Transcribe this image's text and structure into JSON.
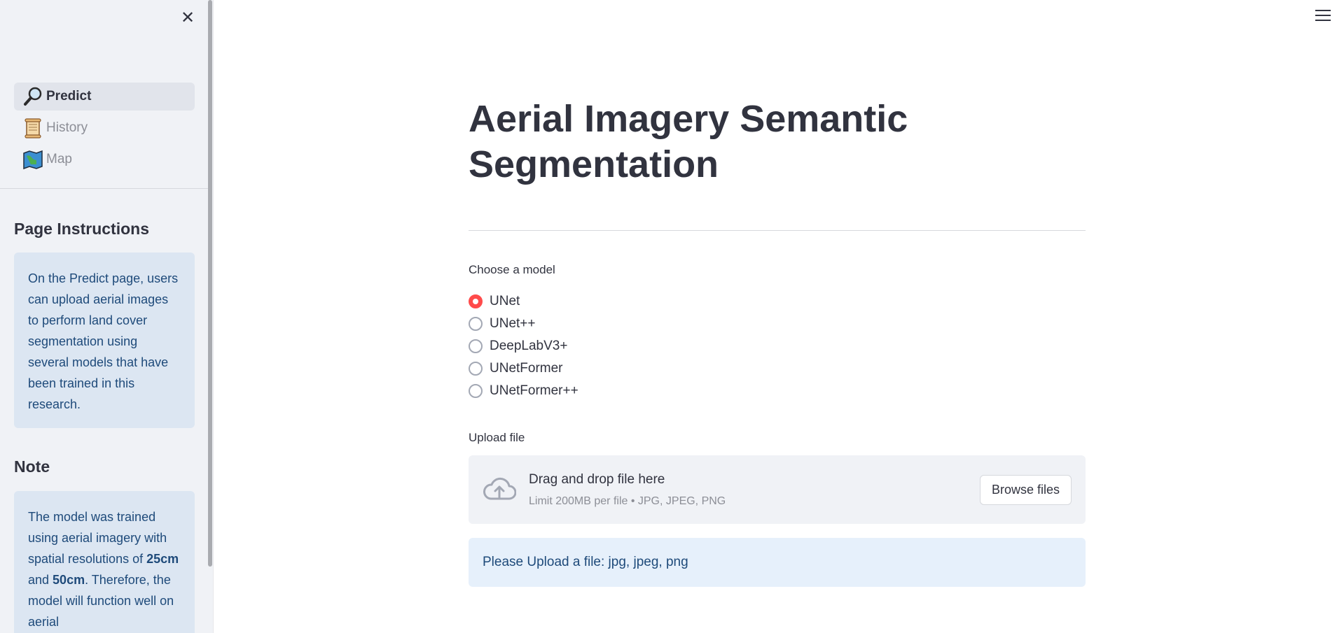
{
  "sidebar": {
    "close_icon": "close-icon",
    "nav": [
      {
        "label": "Predict",
        "icon": "magnifier-icon",
        "active": true
      },
      {
        "label": "History",
        "icon": "scroll-icon",
        "active": false
      },
      {
        "label": "Map",
        "icon": "map-icon",
        "active": false
      }
    ],
    "instructions_heading": "Page Instructions",
    "instructions_text": "On the Predict page, users can upload aerial images to perform land cover segmentation using several models that have been trained in this research.",
    "note_heading": "Note",
    "note": {
      "t1": "The model was trained using aerial imagery with spatial resolutions of ",
      "b1": "25cm",
      "t2": " and ",
      "b2": "50cm",
      "t3": ". Therefore, the model will function well on aerial"
    }
  },
  "header": {
    "menu_icon": "hamburger-menu-icon"
  },
  "main": {
    "title": "Aerial Imagery Semantic Segmentation",
    "model_label": "Choose a model",
    "models": [
      "UNet",
      "UNet++",
      "DeepLabV3+",
      "UNetFormer",
      "UNetFormer++"
    ],
    "selected_model": "UNet",
    "upload_label": "Upload file",
    "dropzone_title": "Drag and drop file here",
    "dropzone_sub": "Limit 200MB per file • JPG, JPEG, PNG",
    "browse_label": "Browse files",
    "alert": "Please Upload a file: jpg, jpeg, png"
  },
  "colors": {
    "accent": "#ff4b4b",
    "sidebar_bg": "#f0f2f6",
    "info_bg": "#dce6f2",
    "alert_bg": "#e6f0fb"
  }
}
